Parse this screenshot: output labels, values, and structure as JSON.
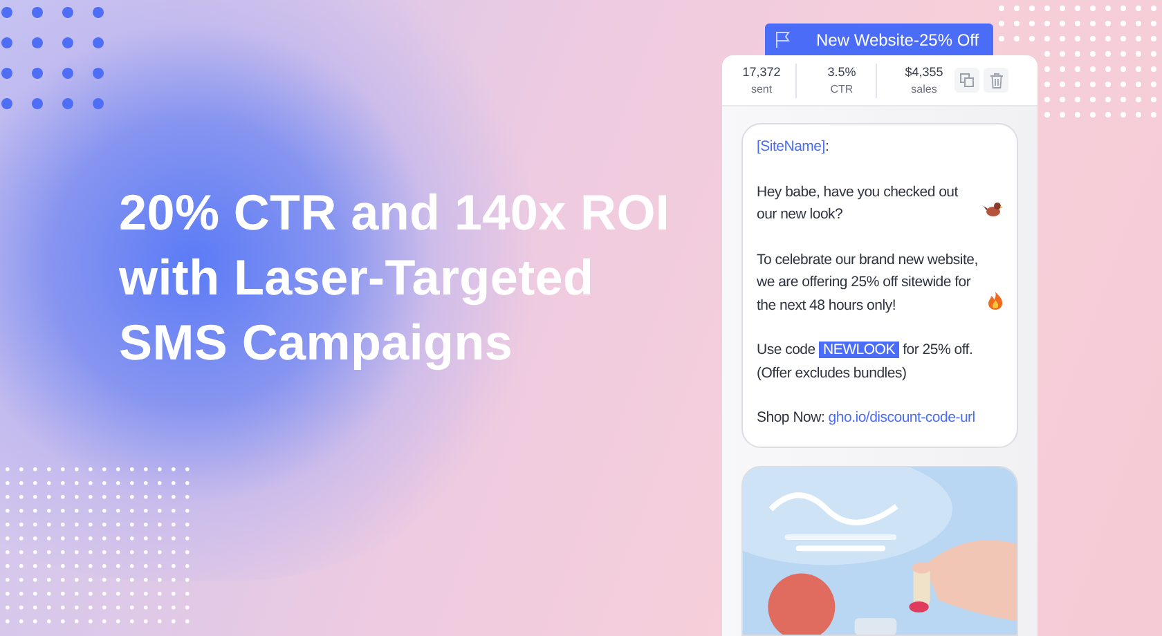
{
  "headline": {
    "lines": [
      "20% CTR and 140x ROI",
      "with Laser-Targeted",
      "SMS Campaigns"
    ]
  },
  "campaign": {
    "title": "New Website-25% Off",
    "stats": [
      {
        "value": "17,372",
        "label": "sent"
      },
      {
        "value": "3.5%",
        "label": "CTR"
      },
      {
        "value": "$4,355",
        "label": "sales"
      }
    ],
    "message": {
      "site_tag": "[SiteName]",
      "site_suffix": ":",
      "greeting": "Hey babe, have you checked out our new look?",
      "announcement": "To celebrate our brand new website, we are offering 25% off sitewide for the next 48 hours only!",
      "code_before": "Use code",
      "code": "NEWLOOK",
      "code_after": "for 25% off.",
      "note": "(Offer excludes bundles)",
      "shop_label": "Shop Now:",
      "shop_link": "gho.io/discount-code-url"
    }
  }
}
